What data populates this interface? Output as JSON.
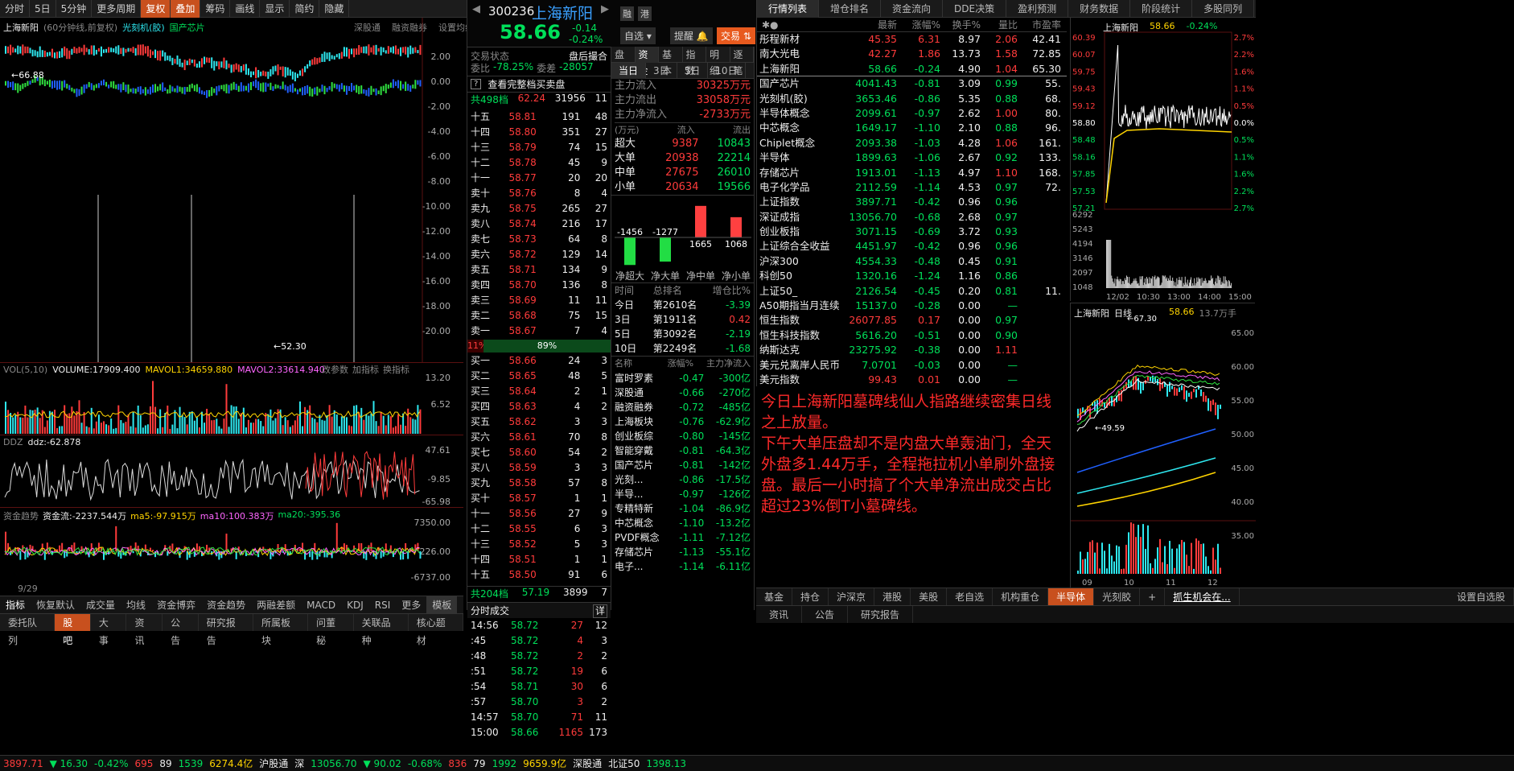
{
  "toolbar": {
    "items": [
      "分时",
      "5日",
      "5分钟",
      "更多周期",
      "复权",
      "叠加",
      "筹码",
      "画线",
      "显示",
      "简约",
      "隐藏"
    ],
    "active": [
      "复权",
      "叠加"
    ]
  },
  "kline": {
    "title": "上海新阳",
    "sub": "(60分钟线,前复权)",
    "tag1": "光刻机(胶)",
    "tag2": "国产芯片",
    "r1": "深股通",
    "r2": "融资融券",
    "r3": "设置均线",
    "high": "66.88",
    "low": "52.30",
    "y_ticks": [
      "2.00",
      "0.00",
      "-2.00",
      "-4.00",
      "-6.00",
      "-8.00",
      "-10.00",
      "-12.00",
      "-14.00",
      "-16.00",
      "-18.00",
      "-20.00"
    ]
  },
  "vol": {
    "name": "VOL(5,10)",
    "volume": "VOLUME:17909.400",
    "ma1": "MAVOL1:34659.880",
    "ma2": "MAVOL2:33614.940",
    "btn1": "改参数",
    "btn2": "加指标",
    "btn3": "换指标",
    "y": [
      "13.20",
      "6.52"
    ]
  },
  "ddz": {
    "name": "DDZ",
    "val": "ddz:-62.878",
    "y": [
      "47.61",
      "-9.85",
      "-65.98"
    ]
  },
  "zjqs": {
    "name": "资金趋势",
    "v1": "资金流:-2237.544万",
    "v2": "ma5:-97.915万",
    "v3": "ma10:100.383万",
    "v4": "ma20:-395.36",
    "y": [
      "7350.00",
      "226.00",
      "-6737.00"
    ],
    "date": "9/29"
  },
  "ind_tabs": [
    "指标",
    "恢复默认",
    "成交量",
    "均线",
    "资金博弈",
    "资金趋势",
    "两融差额",
    "MACD",
    "KDJ",
    "RSI",
    "更多",
    "模板"
  ],
  "bottom_tabs": [
    "委托队列",
    "股吧",
    "大事",
    "资讯",
    "公告",
    "研究报告",
    "所属板块",
    "问董秘",
    "关联品种",
    "核心题材"
  ],
  "quote": {
    "code": "300236",
    "name": "上海新阳",
    "price": "58.66",
    "chg": "-0.14",
    "pct": "-0.24%",
    "b1": "融",
    "b2": "港",
    "sel": "自选",
    "remind": "提醒",
    "trade": "交易"
  },
  "order": {
    "state_l": "交易状态",
    "state_r": "盘后撮合",
    "wb_l": "委比",
    "wb": "-78.25%",
    "wc_l": "委差",
    "wc": "-28057",
    "link": "查看完整档买卖盘",
    "total_sell": "共498档",
    "ts_p": "62.24",
    "ts_v": "31956",
    "ts_n": "11",
    "pct_l": "11%",
    "pct_r": "89%",
    "total_buy": "共204档",
    "tb_p": "57.19",
    "tb_v": "3899",
    "tb_n": "7"
  },
  "asks": [
    [
      "十五",
      "58.81",
      "191",
      "48"
    ],
    [
      "十四",
      "58.80",
      "351",
      "27"
    ],
    [
      "十三",
      "58.79",
      "74",
      "15"
    ],
    [
      "十二",
      "58.78",
      "45",
      "9"
    ],
    [
      "十一",
      "58.77",
      "20",
      "20"
    ],
    [
      "卖十",
      "58.76",
      "8",
      "4"
    ],
    [
      "卖九",
      "58.75",
      "265",
      "27"
    ],
    [
      "卖八",
      "58.74",
      "216",
      "17"
    ],
    [
      "卖七",
      "58.73",
      "64",
      "8"
    ],
    [
      "卖六",
      "58.72",
      "129",
      "14"
    ],
    [
      "卖五",
      "58.71",
      "134",
      "9"
    ],
    [
      "卖四",
      "58.70",
      "136",
      "8"
    ],
    [
      "卖三",
      "58.69",
      "11",
      "11"
    ],
    [
      "卖二",
      "58.68",
      "75",
      "15"
    ],
    [
      "卖一",
      "58.67",
      "7",
      "4"
    ]
  ],
  "bids": [
    [
      "买一",
      "58.66",
      "24",
      "3"
    ],
    [
      "买二",
      "58.65",
      "48",
      "5"
    ],
    [
      "买三",
      "58.64",
      "2",
      "1"
    ],
    [
      "买四",
      "58.63",
      "4",
      "2"
    ],
    [
      "买五",
      "58.62",
      "3",
      "3"
    ],
    [
      "买六",
      "58.61",
      "70",
      "8"
    ],
    [
      "买七",
      "58.60",
      "54",
      "2"
    ],
    [
      "买八",
      "58.59",
      "3",
      "3"
    ],
    [
      "买九",
      "58.58",
      "57",
      "8"
    ],
    [
      "买十",
      "58.57",
      "1",
      "1"
    ],
    [
      "十一",
      "58.56",
      "27",
      "9"
    ],
    [
      "十二",
      "58.55",
      "6",
      "3"
    ],
    [
      "十三",
      "58.52",
      "5",
      "3"
    ],
    [
      "十四",
      "58.51",
      "1",
      "1"
    ],
    [
      "十五",
      "58.50",
      "91",
      "6"
    ]
  ],
  "ticks_title": "分时成交",
  "ticks_btn": "详",
  "ticks": [
    [
      "14:56",
      "58.72",
      "27",
      "12"
    ],
    [
      ":45",
      "58.72",
      "4",
      "3"
    ],
    [
      ":48",
      "58.72",
      "2",
      "2"
    ],
    [
      ":51",
      "58.72",
      "19",
      "6"
    ],
    [
      ":54",
      "58.71",
      "30",
      "6"
    ],
    [
      ":57",
      "58.70",
      "3",
      "2"
    ],
    [
      "14:57",
      "58.70",
      "71",
      "11"
    ],
    [
      "15:00",
      "58.66",
      "1165",
      "173"
    ]
  ],
  "fund": {
    "tabs": [
      "盘口",
      "资金",
      "基本",
      "指数",
      "明细",
      "逐笔"
    ],
    "days": [
      "当日",
      "3日",
      "5日",
      "10日"
    ],
    "in_l": "主力流入",
    "in": "30325万元",
    "out_l": "主力流出",
    "out": "33058万元",
    "net_l": "主力净流入",
    "net": "-2733万元",
    "unit": "(万元)",
    "c1": "流入",
    "c2": "流出",
    "rows": [
      [
        "超大",
        "9387",
        "10843"
      ],
      [
        "大单",
        "20938",
        "22214"
      ],
      [
        "中单",
        "27675",
        "26010"
      ],
      [
        "小单",
        "20634",
        "19566"
      ]
    ],
    "net_bars": [
      {
        "label": "净超大",
        "v": -1456
      },
      {
        "label": "净大单",
        "v": -1277
      },
      {
        "label": "净中单",
        "v": 1665
      },
      {
        "label": "净小单",
        "v": 1068
      }
    ],
    "rank_h": [
      "时间",
      "总排名",
      "增仓比%"
    ],
    "ranks": [
      [
        "今日",
        "第2610名",
        "-3.39"
      ],
      [
        "3日",
        "第1911名",
        "0.42"
      ],
      [
        "5日",
        "第3092名",
        "-2.19"
      ],
      [
        "10日",
        "第2249名",
        "-1.68"
      ]
    ],
    "sec_h": [
      "名称",
      "涨幅%",
      "主力净流入"
    ],
    "sectors": [
      [
        "富时罗素",
        "-0.47",
        "-300亿"
      ],
      [
        "深股通",
        "-0.66",
        "-270亿"
      ],
      [
        "融资融券",
        "-0.72",
        "-485亿"
      ],
      [
        "上海板块",
        "-0.76",
        "-62.9亿"
      ],
      [
        "创业板综",
        "-0.80",
        "-145亿"
      ],
      [
        "智能穿戴",
        "-0.81",
        "-64.3亿"
      ],
      [
        "国产芯片",
        "-0.81",
        "-142亿"
      ],
      [
        "光刻...",
        "-0.86",
        "-17.5亿"
      ],
      [
        "半导...",
        "-0.97",
        "-126亿"
      ],
      [
        "专精特新",
        "-1.04",
        "-86.9亿"
      ],
      [
        "中芯概念",
        "-1.10",
        "-13.2亿"
      ],
      [
        "PVDF概念",
        "-1.11",
        "-7.12亿"
      ],
      [
        "存储芯片",
        "-1.13",
        "-55.1亿"
      ],
      [
        "电子...",
        "-1.14",
        "-6.11亿"
      ]
    ]
  },
  "list": {
    "tabs": [
      "行情列表",
      "增仓排名",
      "资金流向",
      "DDE决策",
      "盈利预测",
      "财务数据",
      "阶段统计",
      "多股同列"
    ],
    "head": [
      "最新",
      "涨幅%",
      "换手%",
      "量比",
      "市盈率"
    ],
    "rows": [
      [
        "彤程新材",
        "45.35",
        "6.31",
        "8.97",
        "2.06",
        "42.41"
      ],
      [
        "南大光电",
        "42.27",
        "1.86",
        "13.73",
        "1.58",
        "72.85"
      ],
      [
        "上海新阳",
        "58.66",
        "-0.24",
        "4.90",
        "1.04",
        "65.30"
      ],
      [
        "国产芯片",
        "4041.43",
        "-0.81",
        "3.09",
        "0.99",
        "55."
      ],
      [
        "光刻机(胶)",
        "3653.46",
        "-0.86",
        "5.35",
        "0.88",
        "68."
      ],
      [
        "半导体概念",
        "2099.61",
        "-0.97",
        "2.62",
        "1.00",
        "80."
      ],
      [
        "中芯概念",
        "1649.17",
        "-1.10",
        "2.10",
        "0.88",
        "96."
      ],
      [
        "Chiplet概念",
        "2093.38",
        "-1.03",
        "4.28",
        "1.06",
        "161."
      ],
      [
        "半导体",
        "1899.63",
        "-1.06",
        "2.67",
        "0.92",
        "133."
      ],
      [
        "存储芯片",
        "1913.01",
        "-1.13",
        "4.97",
        "1.10",
        "168."
      ],
      [
        "电子化学品",
        "2112.59",
        "-1.14",
        "4.53",
        "0.97",
        "72."
      ],
      [
        "上证指数",
        "3897.71",
        "-0.42",
        "0.96",
        "0.96",
        ""
      ],
      [
        "深证成指",
        "13056.70",
        "-0.68",
        "2.68",
        "0.97",
        ""
      ],
      [
        "创业板指",
        "3071.15",
        "-0.69",
        "3.72",
        "0.93",
        ""
      ],
      [
        "上证综合全收益",
        "4451.97",
        "-0.42",
        "0.96",
        "0.96",
        ""
      ],
      [
        "沪深300",
        "4554.33",
        "-0.48",
        "0.45",
        "0.91",
        ""
      ],
      [
        "科创50",
        "1320.16",
        "-1.24",
        "1.16",
        "0.86",
        ""
      ],
      [
        "上证50_",
        "2126.54",
        "-0.45",
        "0.20",
        "0.81",
        "11."
      ],
      [
        "A50期指当月连续",
        "15137.0",
        "-0.28",
        "0.00",
        "—",
        ""
      ],
      [
        "恒生指数",
        "26077.85",
        "0.17",
        "0.00",
        "0.97",
        ""
      ],
      [
        "恒生科技指数",
        "5616.20",
        "-0.51",
        "0.00",
        "0.90",
        ""
      ],
      [
        "纳斯达克",
        "23275.92",
        "-0.38",
        "0.00",
        "1.11",
        ""
      ],
      [
        "美元兑离岸人民币",
        "7.0701",
        "-0.03",
        "0.00",
        "—",
        ""
      ],
      [
        "美元指数",
        "99.43",
        "0.01",
        "0.00",
        "—",
        ""
      ]
    ]
  },
  "note": "今日上海新阳墓碑线仙人指路继续密集日线之上放量。\n下午大单压盘却不是内盘大单轰油门，全天外盘多1.44万手，全程拖拉机小单刷外盘接盘。最后一小时搞了个大单净流出成交占比超过23%倒T小墓碑线。",
  "mini": {
    "name": "上海新阳",
    "price": "58.66",
    "pct": "-0.24%",
    "yl": [
      "60.39",
      "60.07",
      "59.75",
      "59.43",
      "59.12",
      "58.80",
      "58.48",
      "58.16",
      "57.85",
      "57.53",
      "57.21"
    ],
    "yr": [
      "2.7%",
      "2.2%",
      "1.6%",
      "1.1%",
      "0.5%",
      "0.0%",
      "0.5%",
      "1.1%",
      "1.6%",
      "2.2%",
      "2.7%"
    ],
    "vl": [
      "6292",
      "5243",
      "4194",
      "3146",
      "2097",
      "1048"
    ],
    "xt": [
      "12/02",
      "10:30",
      "13:00",
      "14:00",
      "15:00"
    ]
  },
  "daily": {
    "name": "上海新阳",
    "sub": "日线",
    "price": "58.66",
    "vol": "13.7万手",
    "high": "67.30",
    "low": "49.59",
    "yr": [
      "65.00",
      "60.00",
      "55.00",
      "50.00",
      "45.00",
      "40.00",
      "35.00"
    ],
    "xt": [
      "09",
      "10",
      "11",
      "12"
    ]
  },
  "rtabs": [
    "基金",
    "持仓",
    "沪深京",
    "港股",
    "美股",
    "老自选",
    "机构重仓",
    "半导体",
    "光刻胶"
  ],
  "rtab_ext": "抓生机会在...",
  "rtab_set": "设置自选股",
  "rinfo": [
    "资讯",
    "公告",
    "研究报告"
  ],
  "status": [
    {
      "t": "3897.71",
      "c": "red"
    },
    {
      "t": "▼ 16.30",
      "c": "grn"
    },
    {
      "t": "-0.42%",
      "c": "grn"
    },
    {
      "t": "695",
      "c": "red"
    },
    {
      "t": "89",
      "c": "wht"
    },
    {
      "t": "1539",
      "c": "grn"
    },
    {
      "t": "6274.4亿",
      "c": "yel"
    },
    {
      "t": "沪股通",
      "c": "wht"
    },
    {
      "t": "深",
      "c": "wht"
    },
    {
      "t": "13056.70",
      "c": "grn"
    },
    {
      "t": "▼ 90.02",
      "c": "grn"
    },
    {
      "t": "-0.68%",
      "c": "grn"
    },
    {
      "t": "836",
      "c": "red"
    },
    {
      "t": "79",
      "c": "wht"
    },
    {
      "t": "1992",
      "c": "grn"
    },
    {
      "t": "9659.9亿",
      "c": "yel"
    },
    {
      "t": "深股通",
      "c": "wht"
    },
    {
      "t": "北证50",
      "c": "wht"
    },
    {
      "t": "1398.13",
      "c": "grn"
    }
  ]
}
